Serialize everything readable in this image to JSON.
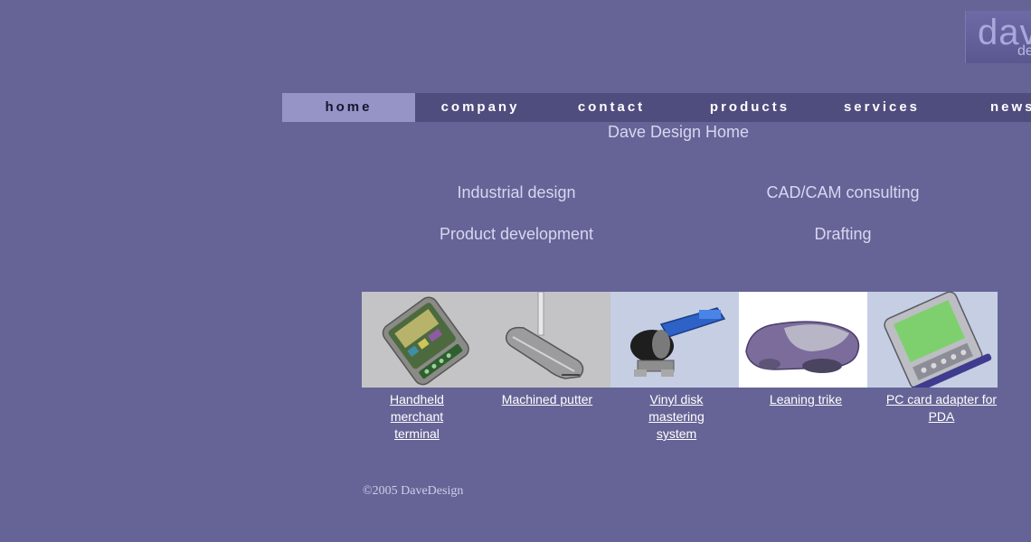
{
  "logo": {
    "main": "dav",
    "sub": "de"
  },
  "nav": {
    "items": [
      {
        "label": "home",
        "active": true
      },
      {
        "label": "company",
        "active": false
      },
      {
        "label": "contact",
        "active": false
      },
      {
        "label": "products",
        "active": false
      },
      {
        "label": "services",
        "active": false
      },
      {
        "label": "news",
        "active": false
      }
    ]
  },
  "page": {
    "heading": "Dave Design Home"
  },
  "services": [
    "Industrial design",
    "CAD/CAM consulting",
    "Product development",
    "Drafting"
  ],
  "products": [
    {
      "label": "Handheld merchant terminal",
      "icon": "handheld-terminal-image"
    },
    {
      "label": "Machined putter",
      "icon": "putter-image"
    },
    {
      "label": "Vinyl disk mastering system",
      "icon": "vinyl-mastering-image"
    },
    {
      "label": "Leaning trike",
      "icon": "leaning-trike-image"
    },
    {
      "label": "PC card adapter for PDA",
      "icon": "pda-adapter-image"
    }
  ],
  "footer": {
    "copyright": "©2005 DaveDesign"
  },
  "colors": {
    "background": "#666496",
    "nav_bar": "#4f4c7e",
    "nav_active": "#9693c6",
    "text_light": "#d8d6f2"
  }
}
